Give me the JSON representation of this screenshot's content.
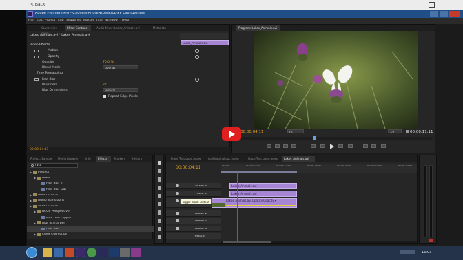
{
  "browser": {
    "back_label": "< Back"
  },
  "title": "Adobe Premiere Pro - C:\\Users\\Andrew\\Desktop\\PP Cs6\\tutorials",
  "menu": [
    "File",
    "Edit",
    "Project",
    "Clip",
    "Sequence",
    "Marker",
    "Title",
    "Window",
    "Help"
  ],
  "effect_controls": {
    "tabs": [
      "Source: (no clips)",
      "Effect Controls",
      "Audio Mixer: Lakes_Animals.avi",
      "Metadata"
    ],
    "breadcrumb": "Lakes_Animals.avi * Lakes_Animals.avi",
    "clip_name": "Lakes_Animals.avi",
    "section": "Video Effects",
    "motion": "Motion",
    "opacity": "Opacity",
    "opacity_prop": "Opacity",
    "opacity_value": "70.0 %",
    "blend_mode_label": "Blend Mode",
    "blend_mode_value": "Overlay",
    "time_remapping": "Time Remapping",
    "fast_blur": "Fast Blur",
    "blurriness_label": "Blurriness",
    "blurriness_value": "2.0",
    "blur_dimensions_label": "Blur Dimensions",
    "blur_dimensions_value": "Vertical",
    "repeat_edge_label": "Repeat Edge Pixels",
    "timecode": "00:00:04:11"
  },
  "program": {
    "tab": "Program: Lakes_Animals.avi",
    "timecode": "00:00:04:11",
    "fit": "Fit",
    "ratio": "1/2",
    "duration": "00:00:11:11"
  },
  "effects_panel": {
    "tabs": [
      "Project: Sample",
      "Media Browser",
      "Info",
      "Effects",
      "Markers",
      "History"
    ],
    "search_value": "fast",
    "tree": [
      {
        "label": "Presets",
        "level": 0
      },
      {
        "label": "Blurs",
        "level": 1
      },
      {
        "label": "Fast Blur In",
        "level": 2
      },
      {
        "label": "Fast Blur Out",
        "level": 2
      },
      {
        "label": "Audio Effects",
        "level": 0
      },
      {
        "label": "Audio Transitions",
        "level": 0
      },
      {
        "label": "Video Effects",
        "level": 0
      },
      {
        "label": "BCC8 Perspective",
        "level": 1
      },
      {
        "label": "BCC Fast Flipper",
        "level": 2
      },
      {
        "label": "Blur & Sharpen",
        "level": 1
      },
      {
        "label": "Fast Blur",
        "level": 2
      },
      {
        "label": "Color Correction",
        "level": 1
      }
    ]
  },
  "timeline": {
    "tabs": [
      "Place Text good.mpeg",
      "trail into hallout.mpeg",
      "Place Text good.mpeg",
      "Lakes_Animals.avi"
    ],
    "timecode": "00:00:04:11",
    "ruler": [
      "00:00",
      "00:00:05:00",
      "00:00:10:00",
      "00:00:15:00",
      "00:00:20:00",
      "00:00:25:00",
      "00:00:30:00"
    ],
    "tracks": [
      "Video 3",
      "Video 2",
      "Video 1",
      "Audio 1",
      "Audio 2",
      "Audio 3",
      "Master"
    ],
    "clip_v3": "Lakes_Animals.avi",
    "clip_v2": "Lakes_Animals.avi",
    "clip_v1": "Lakes_Animals.avi  Opacity:Opacity ▾",
    "tooltip": "Toggle Track Output"
  },
  "taskbar": {
    "clock": "16:03"
  }
}
